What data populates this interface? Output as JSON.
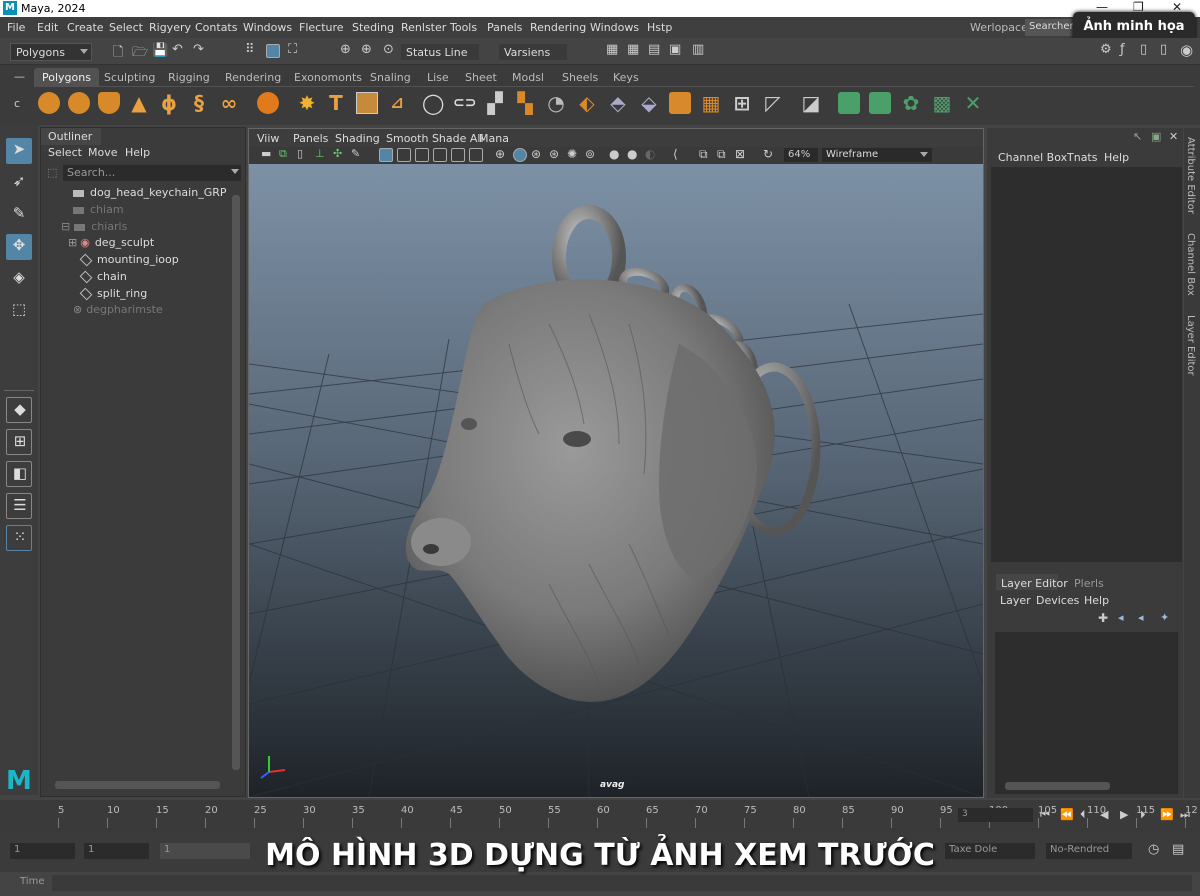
{
  "window": {
    "title": "Maya, 2024",
    "controls": [
      "—",
      "❐",
      "✕"
    ]
  },
  "menubar": {
    "items": [
      "File",
      "Edit",
      "Create",
      "Select",
      "Rigyery",
      "Contats",
      "Windows",
      "Flecture",
      "Steding",
      "Renlster",
      "Tools",
      "Panels",
      "Rendering",
      "Windows",
      "Hstp"
    ],
    "workspace_label": "Werlopace:",
    "workspace_value": "Searchero"
  },
  "badge": "Ảnh minh họa",
  "statusline": {
    "mode": "Polygons",
    "status_line": "Status Line",
    "versions": "Varsiens"
  },
  "shelf": {
    "tabs": [
      "Polygons",
      "Sculpting",
      "Rigging",
      "Rendering",
      "Exonomonts",
      "Snaling",
      "Lise",
      "Sheet",
      "Modsl",
      "Sheels",
      "Keys"
    ],
    "active": "Polygons"
  },
  "outliner": {
    "title": "Outliner",
    "menu": [
      "Select",
      "Move",
      "Help"
    ],
    "search_placeholder": "Search...",
    "items": [
      {
        "label": "dog_head_keychain_GRP",
        "dim": false
      },
      {
        "label": "chiam",
        "dim": true
      },
      {
        "label": "chiarls",
        "dim": true
      },
      {
        "label": "deg_sculpt",
        "dim": false
      },
      {
        "label": "mounting_ioop",
        "dim": false
      },
      {
        "label": "chain",
        "dim": false
      },
      {
        "label": "split_ring",
        "dim": false
      },
      {
        "label": "degpharimste",
        "dim": true
      }
    ]
  },
  "viewport": {
    "menu": [
      "Viiw",
      "Panels",
      "Shading",
      "Smooth Shade All",
      "Mana"
    ],
    "zoom": "64%",
    "shading": "Wireframe",
    "camera": "avag"
  },
  "channelbox": {
    "menu": [
      "Channel Box",
      "Tnats",
      "Help"
    ]
  },
  "layereditor": {
    "tabs": [
      "Layer Editor",
      "Plerls"
    ],
    "menu": [
      "Layer",
      "Devices",
      "Help"
    ]
  },
  "side_tabs": [
    "Attribute Editor",
    "Channel Box",
    "Layer Editor"
  ],
  "timeline": {
    "ticks": [
      "5",
      "10",
      "15",
      "20",
      "25",
      "30",
      "35",
      "40",
      "45",
      "50",
      "55",
      "60",
      "65",
      "70",
      "75",
      "80",
      "85",
      "90",
      "95",
      "100",
      "105",
      "110",
      "115",
      "12"
    ],
    "current": "3"
  },
  "range": {
    "start": "1",
    "start2": "1",
    "mid": "1",
    "anim_label": "Taxe Dole",
    "render": "No-Rendred"
  },
  "bottom": {
    "time_label": "Time"
  },
  "caption": "MÔ HÌNH 3D DỰNG TỪ ẢNH XEM TRƯỚC",
  "colors": {
    "accent": "#5285a6",
    "shelf_orange": "#d8892a",
    "shelf_green": "#4ba06a"
  }
}
